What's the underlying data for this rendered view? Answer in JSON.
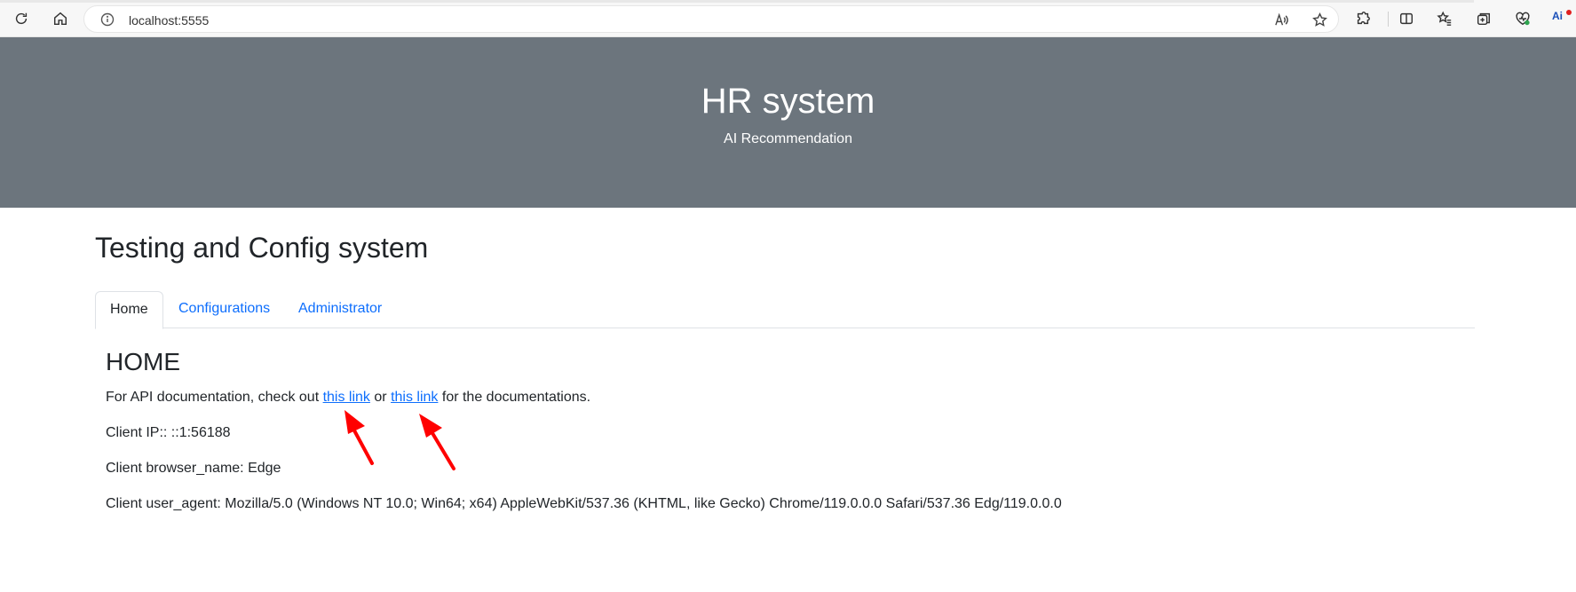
{
  "browser": {
    "url": "localhost:5555",
    "icons": [
      "refresh-icon",
      "home-icon",
      "info-icon",
      "read-aloud-icon",
      "favorite-star-icon",
      "extensions-icon",
      "split-screen-icon",
      "favorites-icon",
      "collections-icon",
      "browser-essentials-icon",
      "ai-badge-icon"
    ],
    "ai_badge": "Ai"
  },
  "header": {
    "title": "HR system",
    "subtitle": "AI Recommendation",
    "background": "#6c757d"
  },
  "main": {
    "page_title": "Testing and Config system",
    "tabs": [
      {
        "label": "Home",
        "active": true
      },
      {
        "label": "Configurations",
        "active": false
      },
      {
        "label": "Administrator",
        "active": false
      }
    ],
    "section_heading": "HOME",
    "api_text_before": "For API documentation, check out ",
    "link1": "this link",
    "api_text_middle": " or ",
    "link2": "this link",
    "api_text_after": " for the documentations.",
    "client_ip": "Client IP:: ::1:56188",
    "client_browser": "Client browser_name: Edge",
    "client_user_agent": "Client user_agent: Mozilla/5.0 (Windows NT 10.0; Win64; x64) AppleWebKit/537.36 (KHTML, like Gecko) Chrome/119.0.0.0 Safari/537.36 Edg/119.0.0.0"
  },
  "colors": {
    "link": "#0d6efd",
    "annotation_arrow": "#ff0000"
  }
}
